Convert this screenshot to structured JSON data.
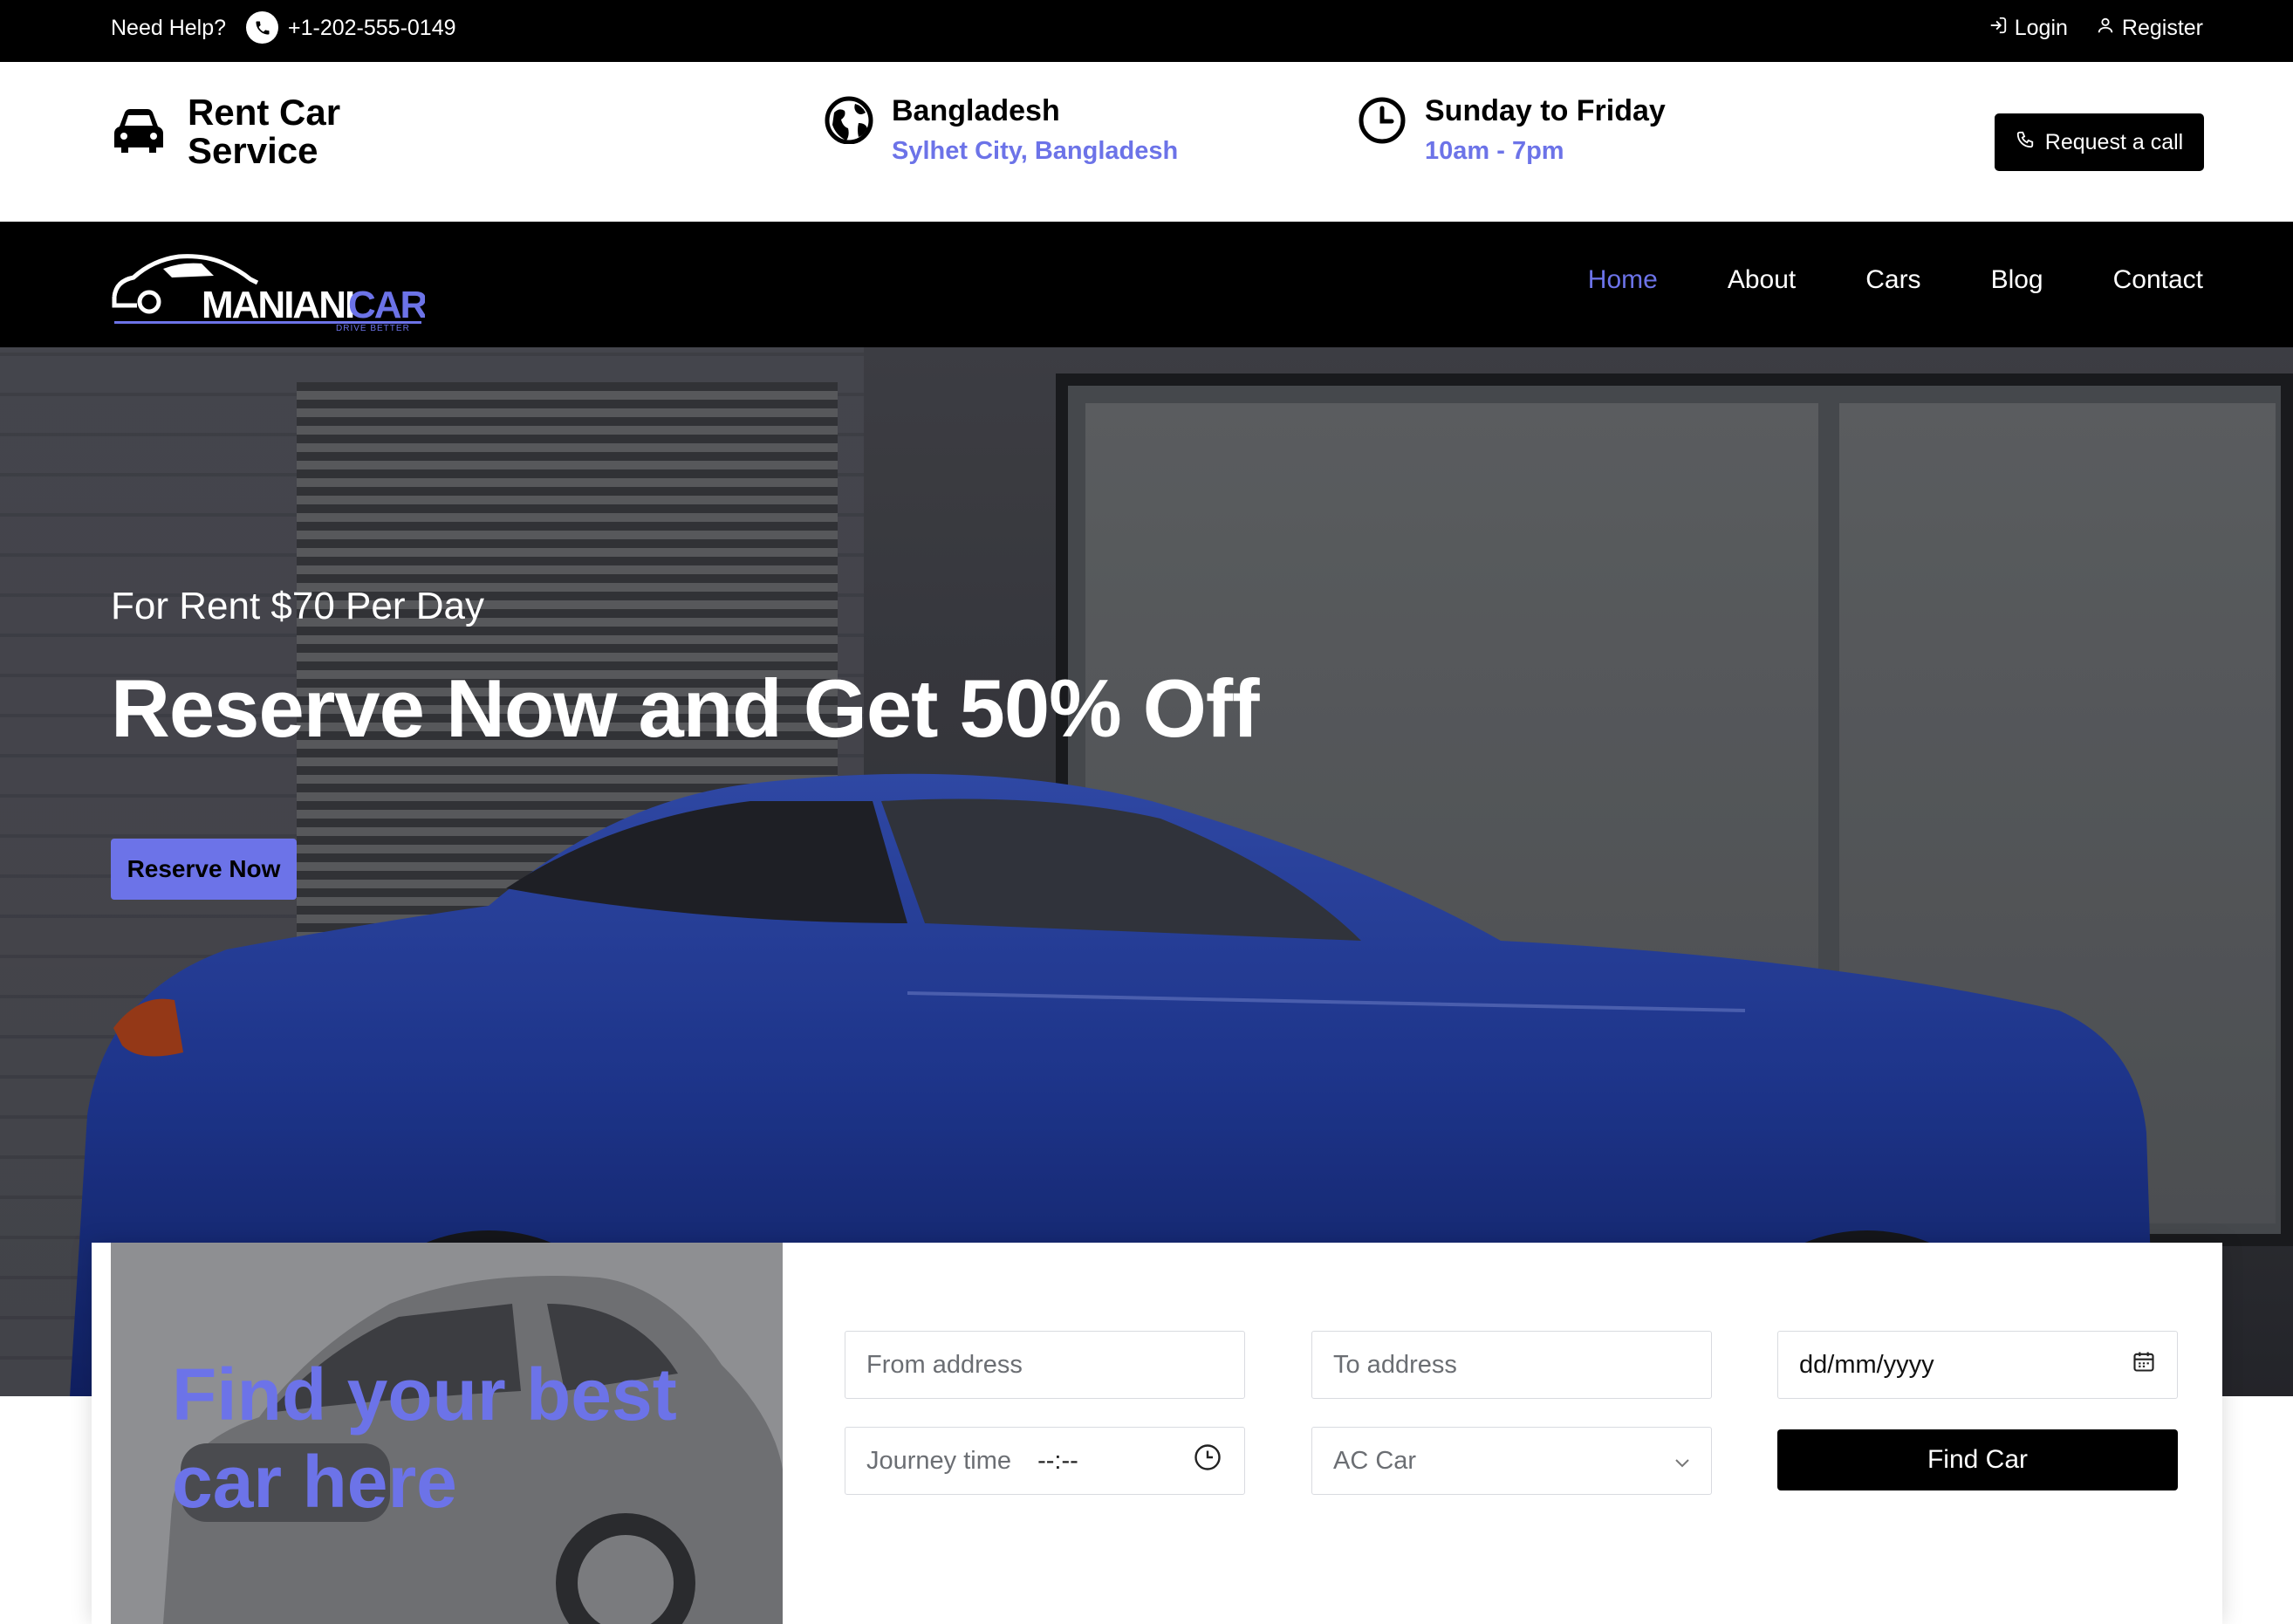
{
  "topbar": {
    "help_label": "Need Help?",
    "phone": "+1-202-555-0149",
    "login_label": "Login",
    "register_label": "Register"
  },
  "header": {
    "brand_title": "Rent Car Service",
    "location": {
      "title": "Bangladesh",
      "subtitle": "Sylhet City, Bangladesh"
    },
    "hours": {
      "title": "Sunday to Friday",
      "subtitle": "10am - 7pm"
    },
    "request_call_label": "Request a call"
  },
  "nav": {
    "logo": {
      "text_main": "MANIANI",
      "text_accent": "CAR",
      "tagline": "DRIVE BETTER"
    },
    "items": [
      {
        "label": "Home",
        "active": true
      },
      {
        "label": "About",
        "active": false
      },
      {
        "label": "Cars",
        "active": false
      },
      {
        "label": "Blog",
        "active": false
      },
      {
        "label": "Contact",
        "active": false
      }
    ]
  },
  "hero": {
    "subtitle": "For Rent $70 Per Day",
    "headline": "Reserve Now and Get 50% Off",
    "cta_label": "Reserve Now"
  },
  "booking": {
    "promo_title": "Find your best car here",
    "from_placeholder": "From address",
    "to_placeholder": "To address",
    "date_placeholder": "dd/mm/yyyy",
    "time_label": "Journey time",
    "time_value": "--:--",
    "car_type_selected": "AC Car",
    "find_label": "Find Car"
  },
  "colors": {
    "accent": "#6c73e8",
    "dark": "#000000",
    "car_blue": "#1f3aa0"
  },
  "icons": [
    "phone-icon",
    "login-icon",
    "user-icon",
    "car-icon",
    "globe-icon",
    "clock-icon",
    "phone-small-icon",
    "calendar-icon",
    "chevron-down-icon"
  ]
}
